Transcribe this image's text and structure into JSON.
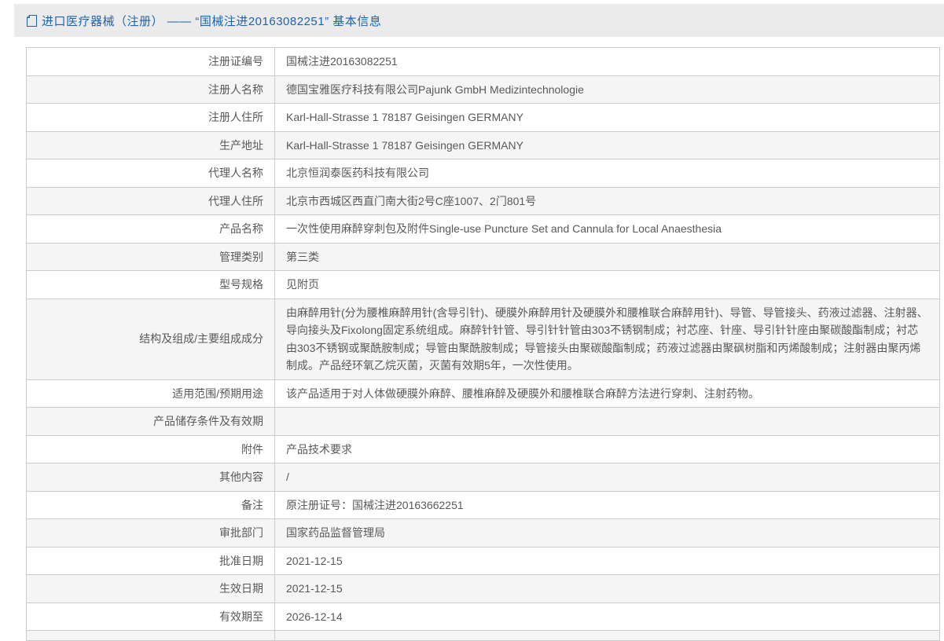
{
  "header": {
    "icon": "document-icon",
    "title": "进口医疗器械（注册） —— “国械注进20163082251” 基本信息"
  },
  "colors": {
    "title_blue": "#1c64ae",
    "header_bar_bg": "#ebebeb",
    "row_alt_bg": "#f5f5f5",
    "table_border": "#cccccc",
    "table_text": "#595959"
  },
  "table": {
    "rows": [
      {
        "label": "注册证编号",
        "value": "国械注进20163082251"
      },
      {
        "label": "注册人名称",
        "value": "德国宝雅医疗科技有限公司Pajunk GmbH Medizintechnologie"
      },
      {
        "label": "注册人住所",
        "value": "Karl-Hall-Strasse 1 78187 Geisingen GERMANY"
      },
      {
        "label": "生产地址",
        "value": "Karl-Hall-Strasse 1 78187 Geisingen GERMANY"
      },
      {
        "label": "代理人名称",
        "value": "北京恒润泰医药科技有限公司"
      },
      {
        "label": "代理人住所",
        "value": "北京市西城区西直门南大街2号C座1007、2门801号"
      },
      {
        "label": "产品名称",
        "value": "一次性使用麻醉穿刺包及附件Single-use Puncture Set and Cannula for Local Anaesthesia"
      },
      {
        "label": "管理类别",
        "value": "第三类"
      },
      {
        "label": "型号规格",
        "value": "见附页"
      },
      {
        "label": "结构及组成/主要组成成分",
        "value": "由麻醉用针(分为腰椎麻醉用针(含导引针)、硬膜外麻醉用针及硬膜外和腰椎联合麻醉用针)、导管、导管接头、药液过滤器、注射器、导向接头及Fixolong固定系统组成。麻醉针针管、导引针针管由303不锈钢制成；衬芯座、针座、导引针针座由聚碳酸酯制成；衬芯由303不锈钢或聚酰胺制成；导管由聚酰胺制成；导管接头由聚碳酸酯制成；药液过滤器由聚砜树脂和丙烯酸制成；注射器由聚丙烯制成。产品经环氧乙烷灭菌，灭菌有效期5年，一次性使用。"
      },
      {
        "label": "适用范围/预期用途",
        "value": "该产品适用于对人体做硬膜外麻醉、腰椎麻醉及硬膜外和腰椎联合麻醉方法进行穿刺、注射药物。"
      },
      {
        "label": "产品储存条件及有效期",
        "value": ""
      },
      {
        "label": "附件",
        "value": "产品技术要求"
      },
      {
        "label": "其他内容",
        "value": "/"
      },
      {
        "label": "备注",
        "value": "原注册证号：国械注进20163662251"
      },
      {
        "label": "审批部门",
        "value": "国家药品监督管理局"
      },
      {
        "label": "批准日期",
        "value": "2021-12-15"
      },
      {
        "label": "生效日期",
        "value": "2021-12-15"
      },
      {
        "label": "有效期至",
        "value": "2026-12-14"
      }
    ]
  }
}
